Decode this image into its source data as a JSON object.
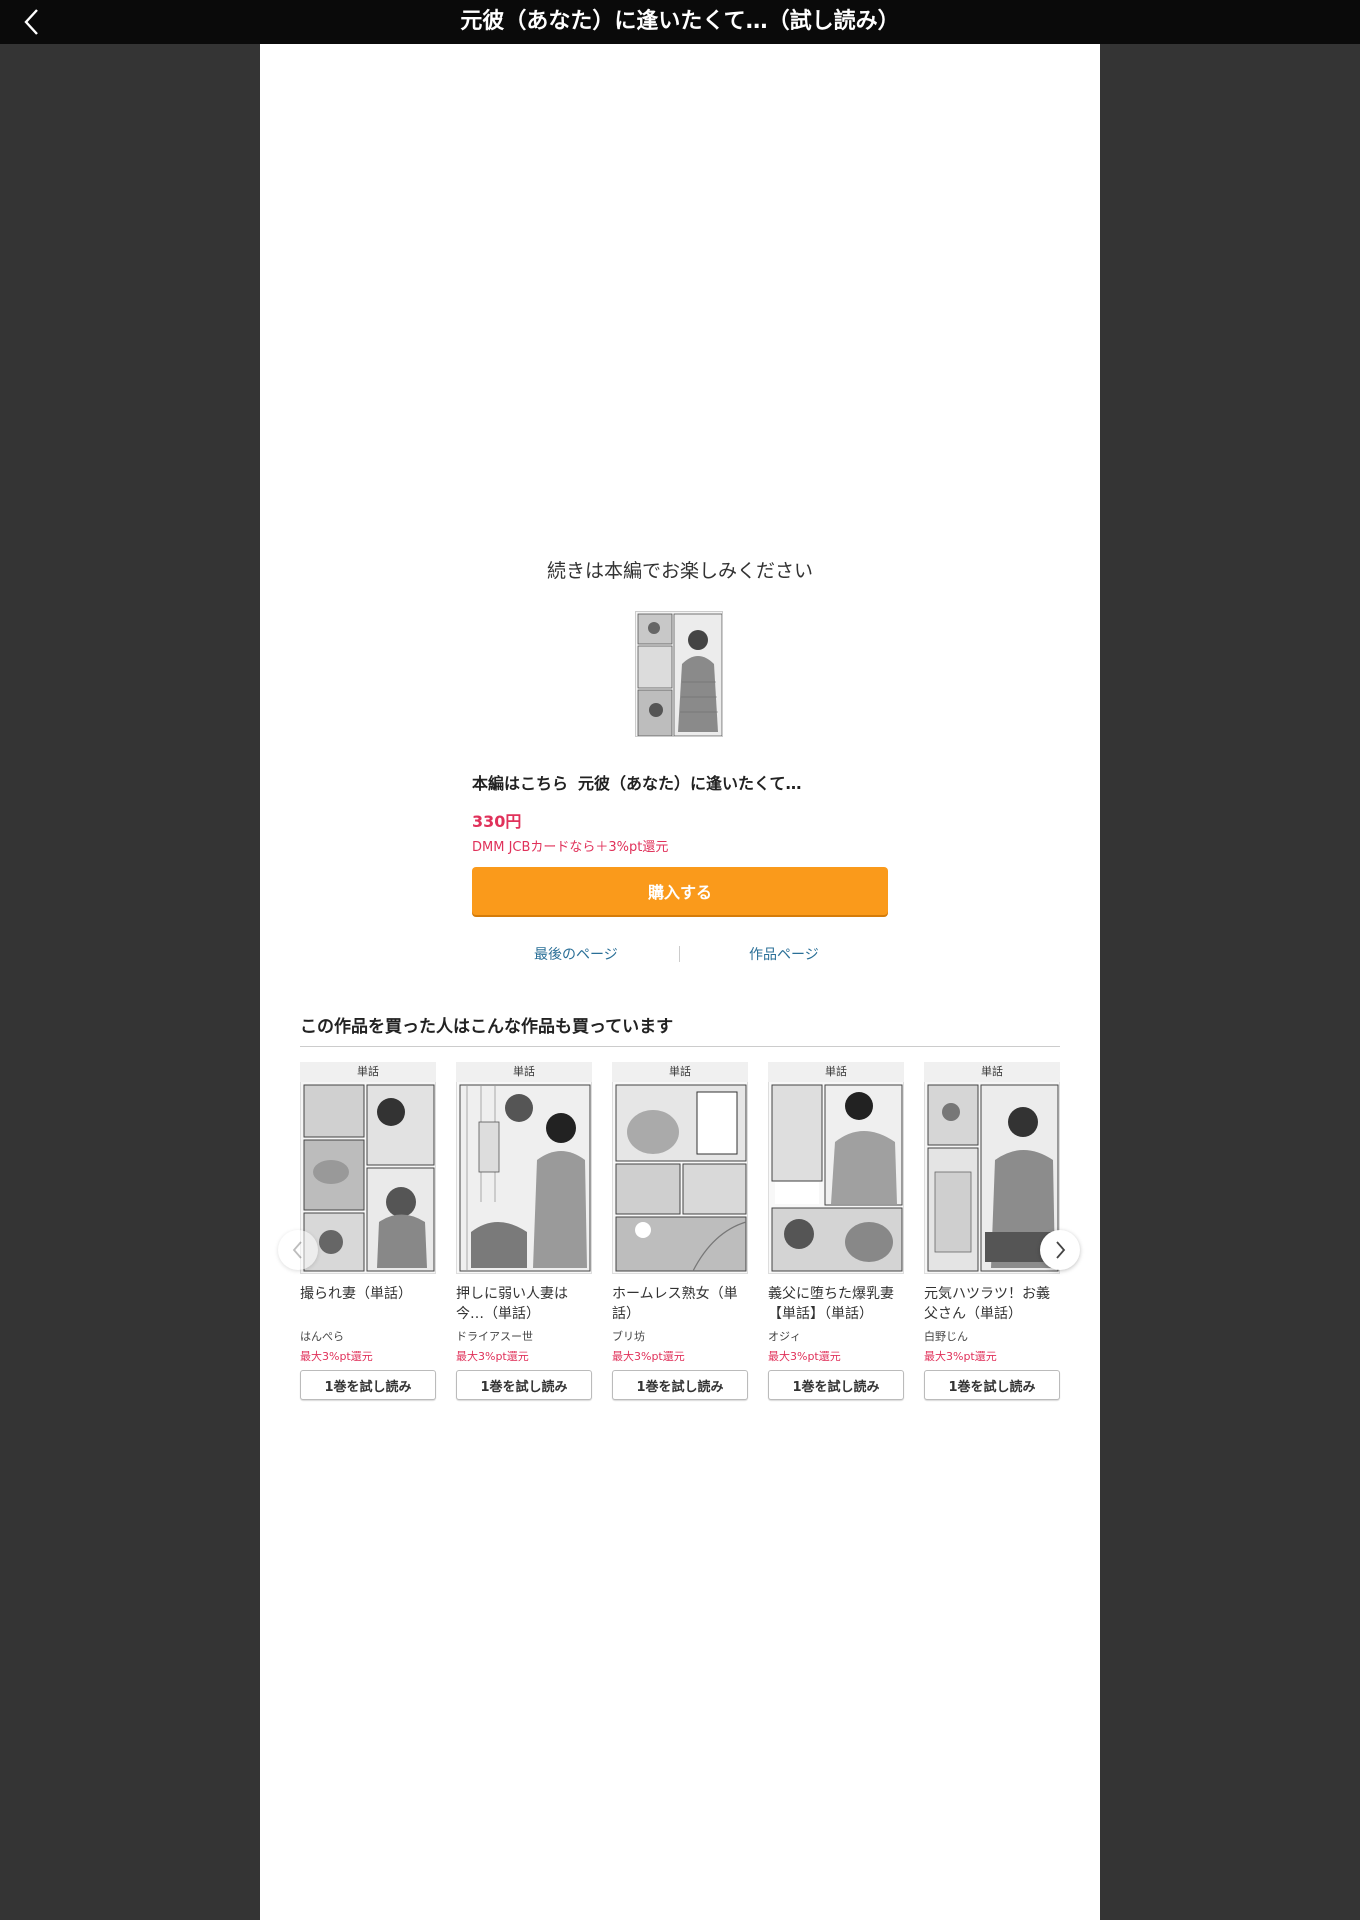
{
  "header": {
    "title": "元彼（あなた）に逢いたくて…（試し読み）",
    "back_icon": "chevron-left-icon"
  },
  "end_panel": {
    "continue_message": "続きは本編でお楽しみください",
    "main_label": "本編はこちら",
    "main_title": "元彼（あなた）に逢いたくて…",
    "price": "330円",
    "points_note": "DMM JCBカードなら＋3%pt還元",
    "buy_label": "購入する",
    "last_page_link": "最後のページ",
    "work_page_link": "作品ページ"
  },
  "recommendations": {
    "heading": "この作品を買った人はこんな作品も買っています",
    "items": [
      {
        "badge": "単話",
        "title": "撮られ妻（単話）",
        "author": "はんぺら",
        "points": "最大3%pt還元",
        "button": "1巻を試し読み"
      },
      {
        "badge": "単話",
        "title": "押しに弱い人妻は今…（単話）",
        "author": "ドライアスー世",
        "points": "最大3%pt還元",
        "button": "1巻を試し読み"
      },
      {
        "badge": "単話",
        "title": "ホームレス熟女（単話）",
        "author": "ブリ坊",
        "points": "最大3%pt還元",
        "button": "1巻を試し読み"
      },
      {
        "badge": "単話",
        "title": "義父に堕ちた爆乳妻【単話】（単話）",
        "author": "オジィ",
        "points": "最大3%pt還元",
        "button": "1巻を試し読み"
      },
      {
        "badge": "単話",
        "title": "元気ハツラツ！お義父さん（単話）",
        "author": "白野じん",
        "points": "最大3%pt還元",
        "button": "1巻を試し読み"
      }
    ]
  },
  "colors": {
    "accent_orange": "#fa9a1b",
    "price_red": "#e0315a",
    "link_blue": "#2a6f97",
    "header_bg": "#0a0a0a",
    "side_bg": "#343434"
  }
}
